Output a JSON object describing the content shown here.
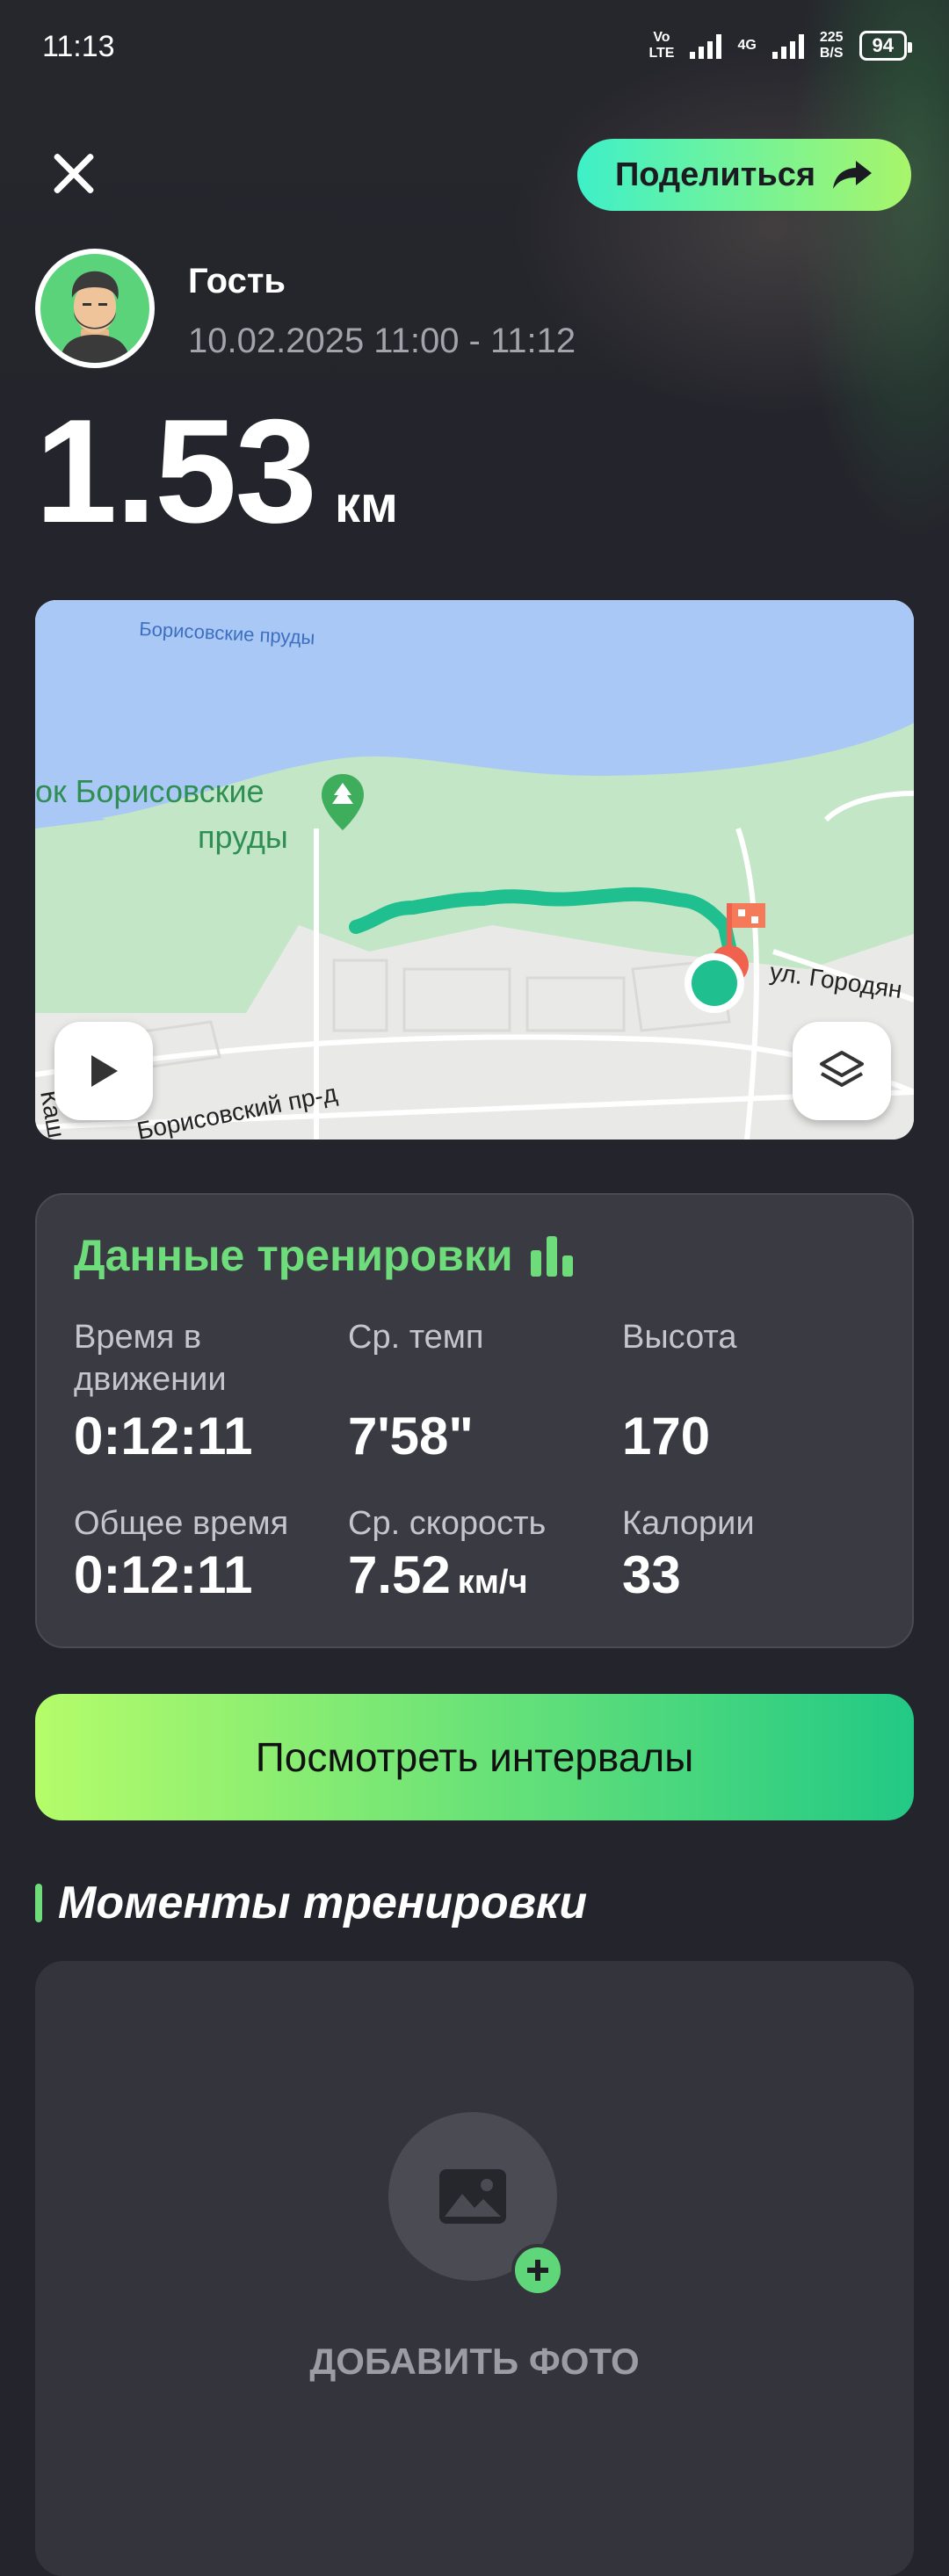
{
  "status": {
    "time": "11:13",
    "network_top": "Vo",
    "network_bottom": "LTE",
    "net_type": "4G",
    "speed_top": "225",
    "speed_bottom": "B/S",
    "battery": "94"
  },
  "header": {
    "share_label": "Поделиться",
    "user_name": "Гость",
    "date_range": "10.02.2025 11:00 - 11:12"
  },
  "distance": {
    "value": "1.53",
    "unit": "км"
  },
  "map": {
    "labels": {
      "ponds_water": "Борисовские пруды",
      "park_line1": "ок Борисовские",
      "park_line2": "пруды",
      "street_gorodyan": "ул. Городян",
      "street_borisovsky": "Борисовский пр-д",
      "street_kash": "Каш"
    },
    "colors": {
      "route": "#1fbf90",
      "water": "#a9c8f5",
      "park": "#c3e6c6"
    }
  },
  "workout": {
    "title": "Данные тренировки",
    "stats": [
      {
        "label": "Время в движении",
        "value": "0:12:11",
        "unit": ""
      },
      {
        "label": "Ср. темп",
        "value": "7'58\"",
        "unit": ""
      },
      {
        "label": "Высота",
        "value": "170",
        "unit": ""
      },
      {
        "label": "Общее время",
        "value": "0:12:11",
        "unit": ""
      },
      {
        "label": "Ср. скорость",
        "value": "7.52",
        "unit": "км/ч"
      },
      {
        "label": "Калории",
        "value": "33",
        "unit": ""
      }
    ]
  },
  "intervals_button": "Посмотреть интервалы",
  "moments": {
    "title": "Моменты тренировки",
    "add_photo": "ДОБАВИТЬ ФОТО"
  }
}
